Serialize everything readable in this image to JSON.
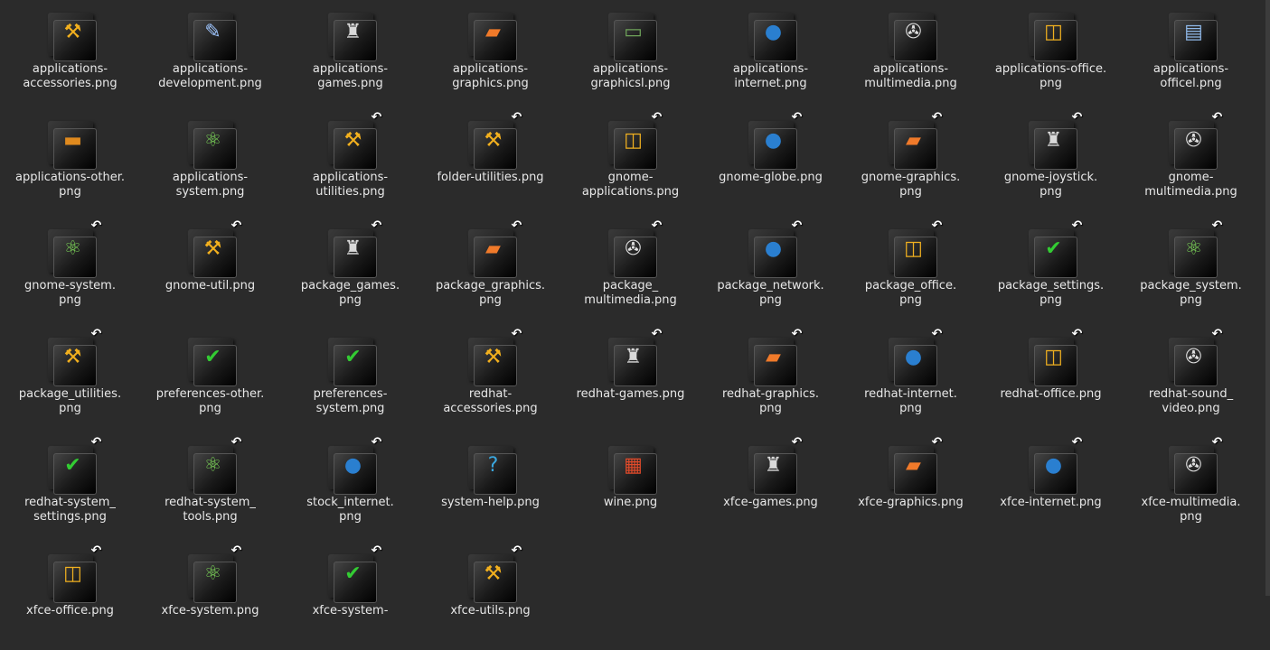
{
  "files": [
    {
      "label": "applications-\naccessories.png",
      "emblem": "drill-icon",
      "link": false
    },
    {
      "label": "applications-\ndevelopment.png",
      "emblem": "pen-icon",
      "link": false
    },
    {
      "label": "applications-\ngames.png",
      "emblem": "joystick-icon",
      "link": false
    },
    {
      "label": "applications-\ngraphics.png",
      "emblem": "paint-icon",
      "link": false
    },
    {
      "label": "applications-\ngraphicsl.png",
      "emblem": "landscape-icon",
      "link": false
    },
    {
      "label": "applications-\ninternet.png",
      "emblem": "globe-icon",
      "link": false
    },
    {
      "label": "applications-\nmultimedia.png",
      "emblem": "clapper-icon",
      "link": false
    },
    {
      "label": "applications-office.\npng",
      "emblem": "office-icon",
      "link": false
    },
    {
      "label": "applications-\nofficel.png",
      "emblem": "documents-icon",
      "link": false
    },
    {
      "label": "applications-other.\npng",
      "emblem": "toolbox-icon",
      "link": false
    },
    {
      "label": "applications-\nsystem.png",
      "emblem": "atom-icon",
      "link": false
    },
    {
      "label": "applications-\nutilities.png",
      "emblem": "drill-icon",
      "link": true
    },
    {
      "label": "folder-utilities.png",
      "emblem": "drill-icon",
      "link": true
    },
    {
      "label": "gnome-\napplications.png",
      "emblem": "office-icon",
      "link": true
    },
    {
      "label": "gnome-globe.png",
      "emblem": "globe-icon",
      "link": true
    },
    {
      "label": "gnome-graphics.\npng",
      "emblem": "paint-icon",
      "link": true
    },
    {
      "label": "gnome-joystick.\npng",
      "emblem": "joystick-icon",
      "link": true
    },
    {
      "label": "gnome-\nmultimedia.png",
      "emblem": "clapper-icon",
      "link": true
    },
    {
      "label": "gnome-system.\npng",
      "emblem": "atom-icon",
      "link": true
    },
    {
      "label": "gnome-util.png",
      "emblem": "drill-icon",
      "link": true
    },
    {
      "label": "package_games.\npng",
      "emblem": "joystick-icon",
      "link": true
    },
    {
      "label": "package_graphics.\npng",
      "emblem": "paint-icon",
      "link": true
    },
    {
      "label": "package_\nmultimedia.png",
      "emblem": "clapper-icon",
      "link": true
    },
    {
      "label": "package_network.\npng",
      "emblem": "globe-icon",
      "link": true
    },
    {
      "label": "package_office.\npng",
      "emblem": "office-icon",
      "link": true
    },
    {
      "label": "package_settings.\npng",
      "emblem": "checkmark-icon",
      "link": true
    },
    {
      "label": "package_system.\npng",
      "emblem": "atom-icon",
      "link": true
    },
    {
      "label": "package_utilities.\npng",
      "emblem": "drill-icon",
      "link": true
    },
    {
      "label": "preferences-other.\npng",
      "emblem": "checkmark-icon",
      "link": false
    },
    {
      "label": "preferences-\nsystem.png",
      "emblem": "checkmark-icon",
      "link": false
    },
    {
      "label": "redhat-\naccessories.png",
      "emblem": "drill-icon",
      "link": true
    },
    {
      "label": "redhat-games.png",
      "emblem": "joystick-icon",
      "link": true
    },
    {
      "label": "redhat-graphics.\npng",
      "emblem": "paint-icon",
      "link": true
    },
    {
      "label": "redhat-internet.\npng",
      "emblem": "globe-icon",
      "link": true
    },
    {
      "label": "redhat-office.png",
      "emblem": "office-icon",
      "link": true
    },
    {
      "label": "redhat-sound_\nvideo.png",
      "emblem": "clapper-icon",
      "link": true
    },
    {
      "label": "redhat-system_\nsettings.png",
      "emblem": "checkmark-icon",
      "link": true
    },
    {
      "label": "redhat-system_\ntools.png",
      "emblem": "atom-icon",
      "link": true
    },
    {
      "label": "stock_internet.\npng",
      "emblem": "globe-icon",
      "link": true
    },
    {
      "label": "system-help.png",
      "emblem": "help-icon",
      "link": false
    },
    {
      "label": "wine.png",
      "emblem": "wine-icon",
      "link": false
    },
    {
      "label": "xfce-games.png",
      "emblem": "joystick-icon",
      "link": true
    },
    {
      "label": "xfce-graphics.png",
      "emblem": "paint-icon",
      "link": true
    },
    {
      "label": "xfce-internet.png",
      "emblem": "globe-icon",
      "link": true
    },
    {
      "label": "xfce-multimedia.\npng",
      "emblem": "clapper-icon",
      "link": true
    },
    {
      "label": "xfce-office.png",
      "emblem": "office-icon",
      "link": true
    },
    {
      "label": "xfce-system.png",
      "emblem": "atom-icon",
      "link": true
    },
    {
      "label": "xfce-system-",
      "emblem": "checkmark-icon",
      "link": true
    },
    {
      "label": "xfce-utils.png",
      "emblem": "drill-icon",
      "link": true
    }
  ],
  "emblem_styles": {
    "drill-icon": {
      "glyph": "⚒",
      "color": "#f2b01e"
    },
    "pen-icon": {
      "glyph": "✎",
      "color": "#9fc6ff"
    },
    "joystick-icon": {
      "glyph": "♜",
      "color": "#d9d9d9"
    },
    "paint-icon": {
      "glyph": "▰",
      "color": "#f07a2a"
    },
    "landscape-icon": {
      "glyph": "▭",
      "color": "#6fa35a"
    },
    "globe-icon": {
      "glyph": "●",
      "color": "#2a7fd0"
    },
    "clapper-icon": {
      "glyph": "✇",
      "color": "#e0e0e0"
    },
    "office-icon": {
      "glyph": "◫",
      "color": "#f0b020"
    },
    "documents-icon": {
      "glyph": "▤",
      "color": "#8fb8e8"
    },
    "toolbox-icon": {
      "glyph": "▬",
      "color": "#e08a1e"
    },
    "atom-icon": {
      "glyph": "⚛",
      "color": "#7fdc5a"
    },
    "checkmark-icon": {
      "glyph": "✔",
      "color": "#33cc33"
    },
    "help-icon": {
      "glyph": "?",
      "color": "#3aa8e0"
    },
    "wine-icon": {
      "glyph": "▦",
      "color": "#e04a2a"
    }
  },
  "link_arrow_glyph": "↶"
}
